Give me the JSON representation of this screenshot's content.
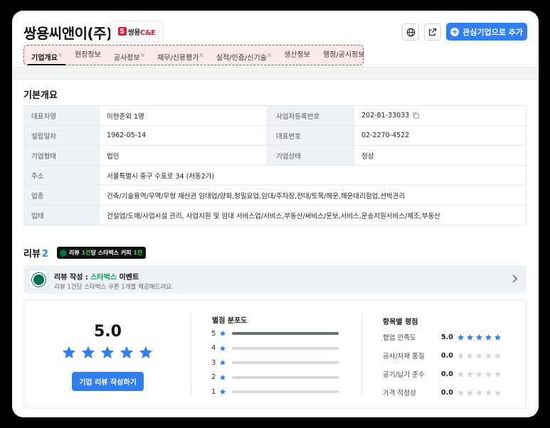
{
  "company": {
    "name": "쌍용씨앤이(주)",
    "logo_text_s": "S",
    "logo_text": "쌍용",
    "logo_text_brand": "C&E"
  },
  "actions": {
    "globe_icon": "globe-icon",
    "share_icon": "external-link-icon",
    "favorite_label": "관심기업으로 추가"
  },
  "tabs": [
    {
      "label": "기업개요",
      "badge": "N",
      "active": true
    },
    {
      "label": "현장정보",
      "badge": ""
    },
    {
      "label": "공사정보",
      "badge": "N"
    },
    {
      "label": "재무/신용평가",
      "badge": "N"
    },
    {
      "label": "실적/인증/신기술",
      "badge": "N"
    },
    {
      "label": "생산정보",
      "badge": ""
    },
    {
      "label": "행정/공시정보",
      "badge": ""
    }
  ],
  "overview": {
    "title": "기본개요",
    "ceo_label": "대표자명",
    "ceo": "이현준외 1명",
    "bizno_label": "사업자등록번호",
    "bizno": "202-81-33033",
    "founded_label": "설립일자",
    "founded": "1962-05-14",
    "phone_label": "대표번호",
    "phone": "02-2270-4522",
    "type_label": "기업형태",
    "type": "법인",
    "status_label": "기업상태",
    "status": "정상",
    "address_label": "주소",
    "address": "서울특별시 중구 수표로 34 (저동2가)",
    "industry_label": "업종",
    "industry": "건축/기술용역/무역/무형 재산권 임대업/양회,청밀요업,임대/주차장,전대/토목/해운,해운대리점업,선박관리",
    "business_label": "업태",
    "business": "건설업/도매/사업시설 관리, 사업지원 및 임대 서비스업/서비스,부동산/써비스/운보,서비스,운송지원서비스/제조,부동산"
  },
  "reviews": {
    "title": "리뷰",
    "count": "2",
    "badge_pre": "리뷰 ",
    "badge_g1": "1건",
    "badge_mid": "당 스타벅스 커피 ",
    "badge_g2": "1잔",
    "event_title_pre": "리뷰 작성 : ",
    "event_title_brand": "스타벅스",
    "event_title_post": " 이벤트",
    "event_sub": "리뷰 1건당 스타벅스 쿠폰 1개를 제공해드려요.",
    "score": "5.0",
    "score_value": 5,
    "write_label": "기업 리뷰 작성하기",
    "dist_title": "별점 분포도",
    "distribution": [
      {
        "star": "5",
        "fraction": 1.0
      },
      {
        "star": "4",
        "fraction": 0
      },
      {
        "star": "3",
        "fraction": 0
      },
      {
        "star": "2",
        "fraction": 0
      },
      {
        "star": "1",
        "fraction": 0
      }
    ],
    "items_title": "항목별 평점",
    "items": [
      {
        "label": "협업 만족도",
        "value": "5.0",
        "stars": 5
      },
      {
        "label": "공사/자재 품질",
        "value": "0.0",
        "stars": 0
      },
      {
        "label": "공기/납기 준수",
        "value": "0.0",
        "stars": 0
      },
      {
        "label": "가격 적정성",
        "value": "0.0",
        "stars": 0
      }
    ]
  },
  "colors": {
    "accent": "#2f7ff2",
    "star_on": "#2f7ff2",
    "star_off": "#d3d6db",
    "tab_highlight": "#e63a46"
  }
}
